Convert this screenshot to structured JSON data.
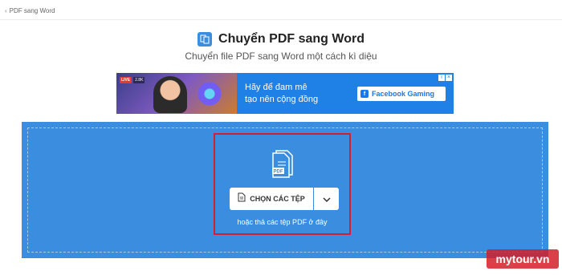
{
  "breadcrumb": {
    "item": "PDF sang Word"
  },
  "header": {
    "title": "Chuyển PDF sang Word",
    "subtitle": "Chuyển file PDF sang Word một cách kì diệu"
  },
  "ad": {
    "live_label": "LIVE",
    "viewer_count": "2.8K",
    "line1": "Hãy để đam mê",
    "line2": "tạo nên cộng đồng",
    "brand": "Facebook Gaming",
    "brand_icon": "facebook-gaming-icon",
    "info_icon": "ad-info-icon",
    "close_icon": "ad-close-icon"
  },
  "upload": {
    "file_icon": "pdf-file-icon",
    "file_label": "PDF",
    "choose_label": "CHỌN CÁC TỆP",
    "dropdown_icon": "chevron-down-icon",
    "hint": "hoặc thả các tệp PDF ở đây"
  },
  "watermark": "mytour.vn",
  "colors": {
    "accent": "#3b8de0",
    "highlight": "#d0202f",
    "ad_blue": "#1f80e6"
  }
}
